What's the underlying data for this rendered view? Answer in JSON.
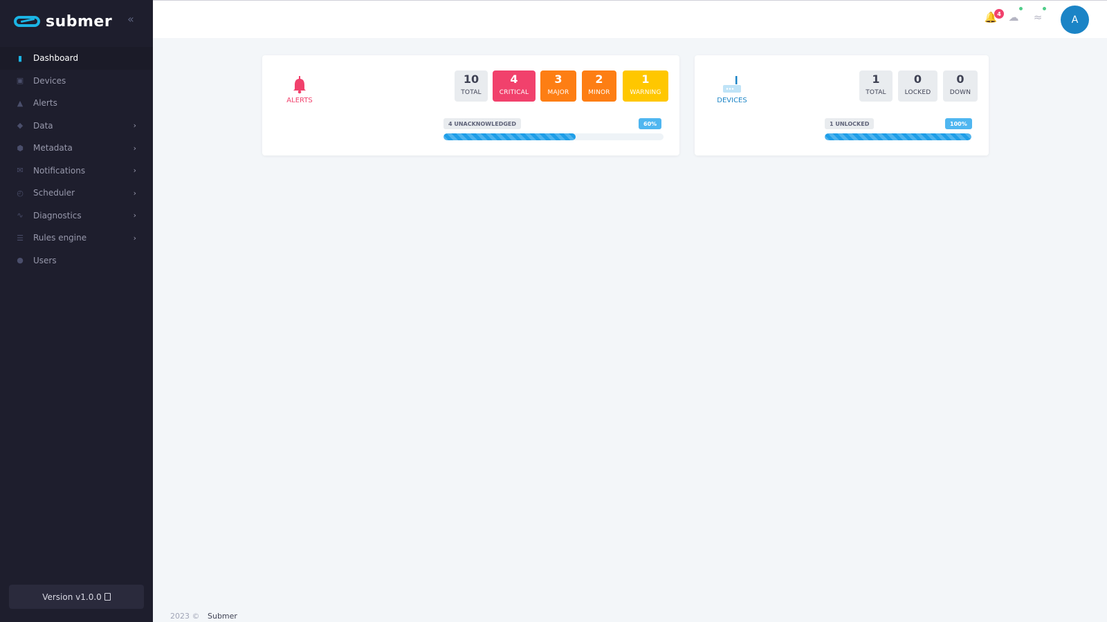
{
  "brand": {
    "name": "submer",
    "accent": "#1bb4e4"
  },
  "sidebar": {
    "items": [
      {
        "label": "Dashboard"
      },
      {
        "label": "Devices"
      },
      {
        "label": "Alerts"
      },
      {
        "label": "Data"
      },
      {
        "label": "Metadata"
      },
      {
        "label": "Notifications"
      },
      {
        "label": "Scheduler"
      },
      {
        "label": "Diagnostics"
      },
      {
        "label": "Rules engine"
      },
      {
        "label": "Users"
      }
    ],
    "version": "Version v1.0.0"
  },
  "header": {
    "notification_count": "4",
    "avatar_initial": "A"
  },
  "alerts_card": {
    "label": "ALERTS",
    "stats": [
      {
        "value": "10",
        "label": "TOTAL"
      },
      {
        "value": "4",
        "label": "CRITICAL"
      },
      {
        "value": "3",
        "label": "MAJOR"
      },
      {
        "value": "2",
        "label": "MINOR"
      },
      {
        "value": "1",
        "label": "WARNING"
      }
    ],
    "progress_label": "4 UNACKNOWLEDGED",
    "progress_percent_text": "60%",
    "progress_fraction": 0.6
  },
  "devices_card": {
    "label": "DEVICES",
    "stats": [
      {
        "value": "1",
        "label": "TOTAL"
      },
      {
        "value": "0",
        "label": "LOCKED"
      },
      {
        "value": "0",
        "label": "DOWN"
      }
    ],
    "progress_label": "1 UNLOCKED",
    "progress_percent_text": "100%",
    "progress_fraction": 1.0
  },
  "footer": {
    "year": "2023 ©",
    "company": "Submer"
  },
  "colors": {
    "sidebar_bg": "#1e1e2d",
    "critical": "#f1416c",
    "major": "#fd7e14",
    "minor": "#fd7e14",
    "warning": "#ffc700",
    "progress": "#1e9ee8",
    "avatar": "#1b84c6"
  }
}
